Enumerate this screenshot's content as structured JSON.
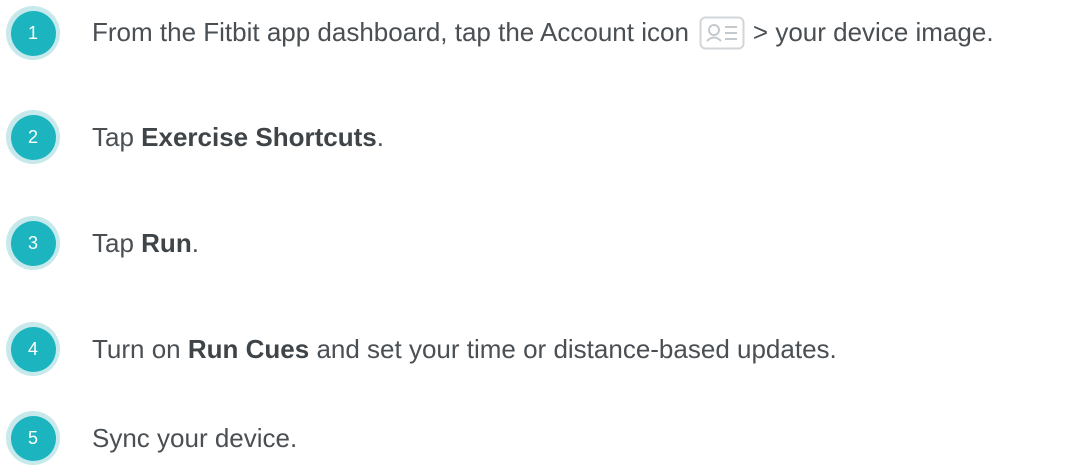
{
  "steps": [
    {
      "number": "1",
      "text_before": "From the Fitbit app dashboard, tap the Account icon",
      "icon": "account-card-icon",
      "text_after": "> your device image."
    },
    {
      "number": "2",
      "text_before": "Tap ",
      "bold": "Exercise Shortcuts",
      "text_after": "."
    },
    {
      "number": "3",
      "text_before": "Tap ",
      "bold": "Run",
      "text_after": "."
    },
    {
      "number": "4",
      "text_before": "Turn on ",
      "bold": "Run Cues",
      "text_after": " and set your time or distance-based updates."
    },
    {
      "number": "5",
      "text_before": "Sync your device."
    }
  ],
  "colors": {
    "badge_fill": "#1cb5bf",
    "badge_ring": "#c7e9eb",
    "text": "#4a4f54"
  }
}
